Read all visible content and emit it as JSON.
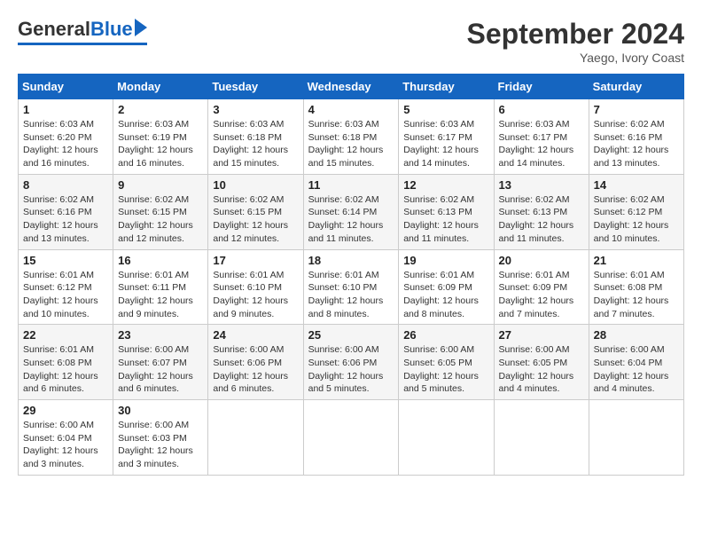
{
  "logo": {
    "general": "General",
    "blue": "Blue"
  },
  "title": "September 2024",
  "location": "Yaego, Ivory Coast",
  "days_of_week": [
    "Sunday",
    "Monday",
    "Tuesday",
    "Wednesday",
    "Thursday",
    "Friday",
    "Saturday"
  ],
  "weeks": [
    [
      {
        "day": "1",
        "sunrise": "6:03 AM",
        "sunset": "6:20 PM",
        "daylight": "12 hours and 16 minutes."
      },
      {
        "day": "2",
        "sunrise": "6:03 AM",
        "sunset": "6:19 PM",
        "daylight": "12 hours and 16 minutes."
      },
      {
        "day": "3",
        "sunrise": "6:03 AM",
        "sunset": "6:18 PM",
        "daylight": "12 hours and 15 minutes."
      },
      {
        "day": "4",
        "sunrise": "6:03 AM",
        "sunset": "6:18 PM",
        "daylight": "12 hours and 15 minutes."
      },
      {
        "day": "5",
        "sunrise": "6:03 AM",
        "sunset": "6:17 PM",
        "daylight": "12 hours and 14 minutes."
      },
      {
        "day": "6",
        "sunrise": "6:03 AM",
        "sunset": "6:17 PM",
        "daylight": "12 hours and 14 minutes."
      },
      {
        "day": "7",
        "sunrise": "6:02 AM",
        "sunset": "6:16 PM",
        "daylight": "12 hours and 13 minutes."
      }
    ],
    [
      {
        "day": "8",
        "sunrise": "6:02 AM",
        "sunset": "6:16 PM",
        "daylight": "12 hours and 13 minutes."
      },
      {
        "day": "9",
        "sunrise": "6:02 AM",
        "sunset": "6:15 PM",
        "daylight": "12 hours and 12 minutes."
      },
      {
        "day": "10",
        "sunrise": "6:02 AM",
        "sunset": "6:15 PM",
        "daylight": "12 hours and 12 minutes."
      },
      {
        "day": "11",
        "sunrise": "6:02 AM",
        "sunset": "6:14 PM",
        "daylight": "12 hours and 11 minutes."
      },
      {
        "day": "12",
        "sunrise": "6:02 AM",
        "sunset": "6:13 PM",
        "daylight": "12 hours and 11 minutes."
      },
      {
        "day": "13",
        "sunrise": "6:02 AM",
        "sunset": "6:13 PM",
        "daylight": "12 hours and 11 minutes."
      },
      {
        "day": "14",
        "sunrise": "6:02 AM",
        "sunset": "6:12 PM",
        "daylight": "12 hours and 10 minutes."
      }
    ],
    [
      {
        "day": "15",
        "sunrise": "6:01 AM",
        "sunset": "6:12 PM",
        "daylight": "12 hours and 10 minutes."
      },
      {
        "day": "16",
        "sunrise": "6:01 AM",
        "sunset": "6:11 PM",
        "daylight": "12 hours and 9 minutes."
      },
      {
        "day": "17",
        "sunrise": "6:01 AM",
        "sunset": "6:10 PM",
        "daylight": "12 hours and 9 minutes."
      },
      {
        "day": "18",
        "sunrise": "6:01 AM",
        "sunset": "6:10 PM",
        "daylight": "12 hours and 8 minutes."
      },
      {
        "day": "19",
        "sunrise": "6:01 AM",
        "sunset": "6:09 PM",
        "daylight": "12 hours and 8 minutes."
      },
      {
        "day": "20",
        "sunrise": "6:01 AM",
        "sunset": "6:09 PM",
        "daylight": "12 hours and 7 minutes."
      },
      {
        "day": "21",
        "sunrise": "6:01 AM",
        "sunset": "6:08 PM",
        "daylight": "12 hours and 7 minutes."
      }
    ],
    [
      {
        "day": "22",
        "sunrise": "6:01 AM",
        "sunset": "6:08 PM",
        "daylight": "12 hours and 6 minutes."
      },
      {
        "day": "23",
        "sunrise": "6:00 AM",
        "sunset": "6:07 PM",
        "daylight": "12 hours and 6 minutes."
      },
      {
        "day": "24",
        "sunrise": "6:00 AM",
        "sunset": "6:06 PM",
        "daylight": "12 hours and 6 minutes."
      },
      {
        "day": "25",
        "sunrise": "6:00 AM",
        "sunset": "6:06 PM",
        "daylight": "12 hours and 5 minutes."
      },
      {
        "day": "26",
        "sunrise": "6:00 AM",
        "sunset": "6:05 PM",
        "daylight": "12 hours and 5 minutes."
      },
      {
        "day": "27",
        "sunrise": "6:00 AM",
        "sunset": "6:05 PM",
        "daylight": "12 hours and 4 minutes."
      },
      {
        "day": "28",
        "sunrise": "6:00 AM",
        "sunset": "6:04 PM",
        "daylight": "12 hours and 4 minutes."
      }
    ],
    [
      {
        "day": "29",
        "sunrise": "6:00 AM",
        "sunset": "6:04 PM",
        "daylight": "12 hours and 3 minutes."
      },
      {
        "day": "30",
        "sunrise": "6:00 AM",
        "sunset": "6:03 PM",
        "daylight": "12 hours and 3 minutes."
      },
      null,
      null,
      null,
      null,
      null
    ]
  ]
}
